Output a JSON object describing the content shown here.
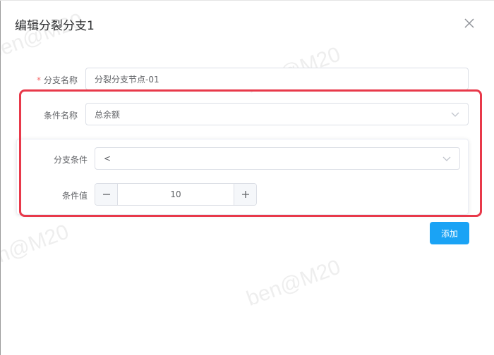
{
  "dialog": {
    "title": "编辑分裂分支1",
    "close_icon": "close-icon"
  },
  "form": {
    "branch_name": {
      "required_mark": "*",
      "label": "分支名称",
      "value": "分裂分支节点-01"
    },
    "condition_name": {
      "label": "条件名称",
      "value": "总余额",
      "arrow_icon": "chevron-down-icon"
    },
    "branch_condition": {
      "label": "分支条件",
      "value": "<",
      "arrow_icon": "chevron-down-icon"
    },
    "condition_value": {
      "label": "条件值",
      "value": "10",
      "minus_icon": "minus-icon",
      "plus_icon": "plus-icon"
    }
  },
  "actions": {
    "add_label": "添加"
  },
  "watermark": {
    "text": "ben@M20"
  },
  "colors": {
    "primary": "#1aa3f5",
    "highlight": "#e8394a",
    "required": "#f56c6c"
  }
}
